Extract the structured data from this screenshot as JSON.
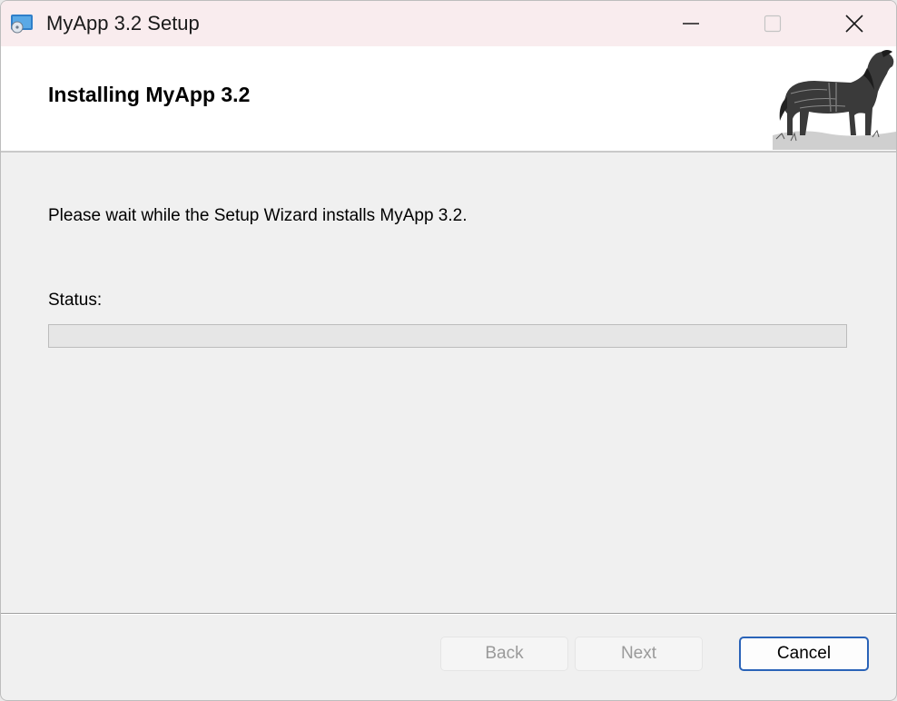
{
  "window": {
    "title": "MyApp 3.2 Setup",
    "controls": {
      "minimize_icon": "minimize-icon",
      "maximize_icon": "maximize-icon",
      "close_icon": "close-icon"
    }
  },
  "banner": {
    "heading": "Installing MyApp 3.2",
    "image": "horse-engraving-image"
  },
  "body": {
    "message": "Please wait while the Setup Wizard installs MyApp 3.2.",
    "status_label": "Status:",
    "progress_value": 0
  },
  "buttons": {
    "back": "Back",
    "next": "Next",
    "cancel": "Cancel"
  },
  "colors": {
    "titlebar": "#f9ecee",
    "accent_border": "#2a63b8",
    "banner_bg": "#ffffff",
    "dialog_bg": "#f0f0f0"
  }
}
